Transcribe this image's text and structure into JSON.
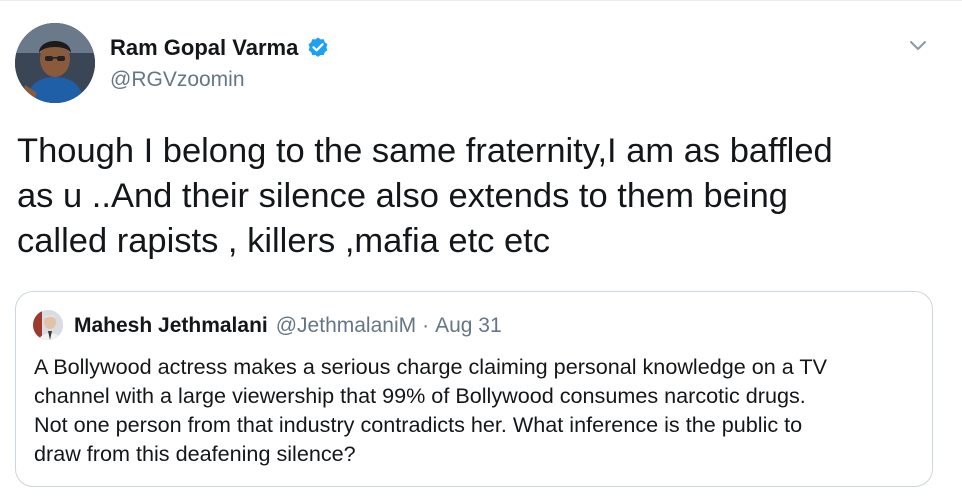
{
  "author": {
    "display_name": "Ram Gopal Varma",
    "handle": "@RGVzoomin",
    "verified": true,
    "avatar_icon": "user-avatar-photo"
  },
  "tweet": {
    "text": "Though I belong to the same fraternity,I am as baffled\nas u ..And their silence also extends to them being\ncalled rapists , killers ,mafia etc etc"
  },
  "quoted_tweet": {
    "display_name": "Mahesh Jethmalani",
    "handle": "@JethmalaniM",
    "separator": "·",
    "date": "Aug 31",
    "text": "A Bollywood actress makes a serious charge claiming personal knowledge on a TV\nchannel with a large viewership that 99% of Bollywood consumes narcotic drugs.\nNot one person from that industry contradicts her. What inference is the public to\ndraw from this deafening silence?"
  },
  "colors": {
    "verified_blue": "#1da1f2",
    "secondary_text": "#657786",
    "border": "#ccd6dd"
  },
  "icons": {
    "more_options": "chevron-down-icon",
    "verified": "verified-badge-icon"
  }
}
